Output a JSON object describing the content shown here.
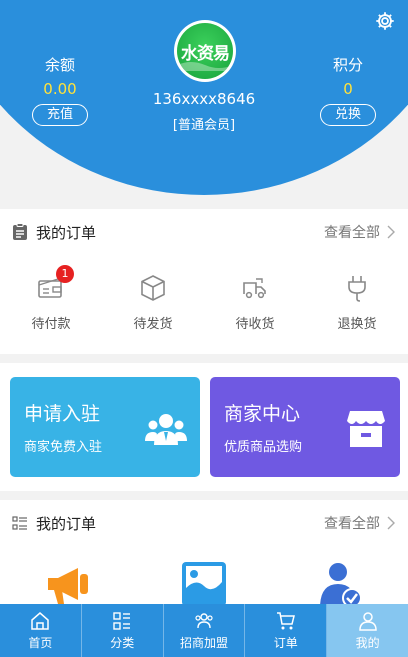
{
  "header": {
    "balance_label": "余额",
    "balance_value": "0.00",
    "recharge_label": "充值",
    "points_label": "积分",
    "points_value": "0",
    "exchange_label": "兑换",
    "avatar_text": "水资易",
    "phone": "136xxxx8646",
    "member_level": "[普通会员]",
    "settings_icon": "gear-icon"
  },
  "orders": {
    "title": "我的订单",
    "view_all": "查看全部",
    "items": [
      {
        "label": "待付款",
        "icon": "wallet-icon",
        "badge": "1"
      },
      {
        "label": "待发货",
        "icon": "box-icon"
      },
      {
        "label": "待收货",
        "icon": "truck-icon"
      },
      {
        "label": "退换货",
        "icon": "return-icon"
      }
    ]
  },
  "banners": [
    {
      "title": "申请入驻",
      "subtitle": "商家免费入驻",
      "icon": "users-icon",
      "color": "#38b3e6"
    },
    {
      "title": "商家中心",
      "subtitle": "优质商品选购",
      "icon": "store-icon",
      "color": "#6f59e2"
    }
  ],
  "tools": {
    "title": "我的订单",
    "view_all": "查看全部",
    "items": [
      {
        "icon": "megaphone-icon"
      },
      {
        "icon": "image-icon"
      },
      {
        "icon": "person-check-icon"
      }
    ]
  },
  "nav": {
    "items": [
      {
        "label": "首页",
        "icon": "home-icon"
      },
      {
        "label": "分类",
        "icon": "grid-list-icon"
      },
      {
        "label": "招商加盟",
        "icon": "group-icon"
      },
      {
        "label": "订单",
        "icon": "cart-icon"
      },
      {
        "label": "我的",
        "icon": "user-icon",
        "active": true
      }
    ]
  },
  "colors": {
    "primary": "#2a8fdc",
    "accent_yellow": "#ffe23b",
    "badge_red": "#e62121"
  }
}
